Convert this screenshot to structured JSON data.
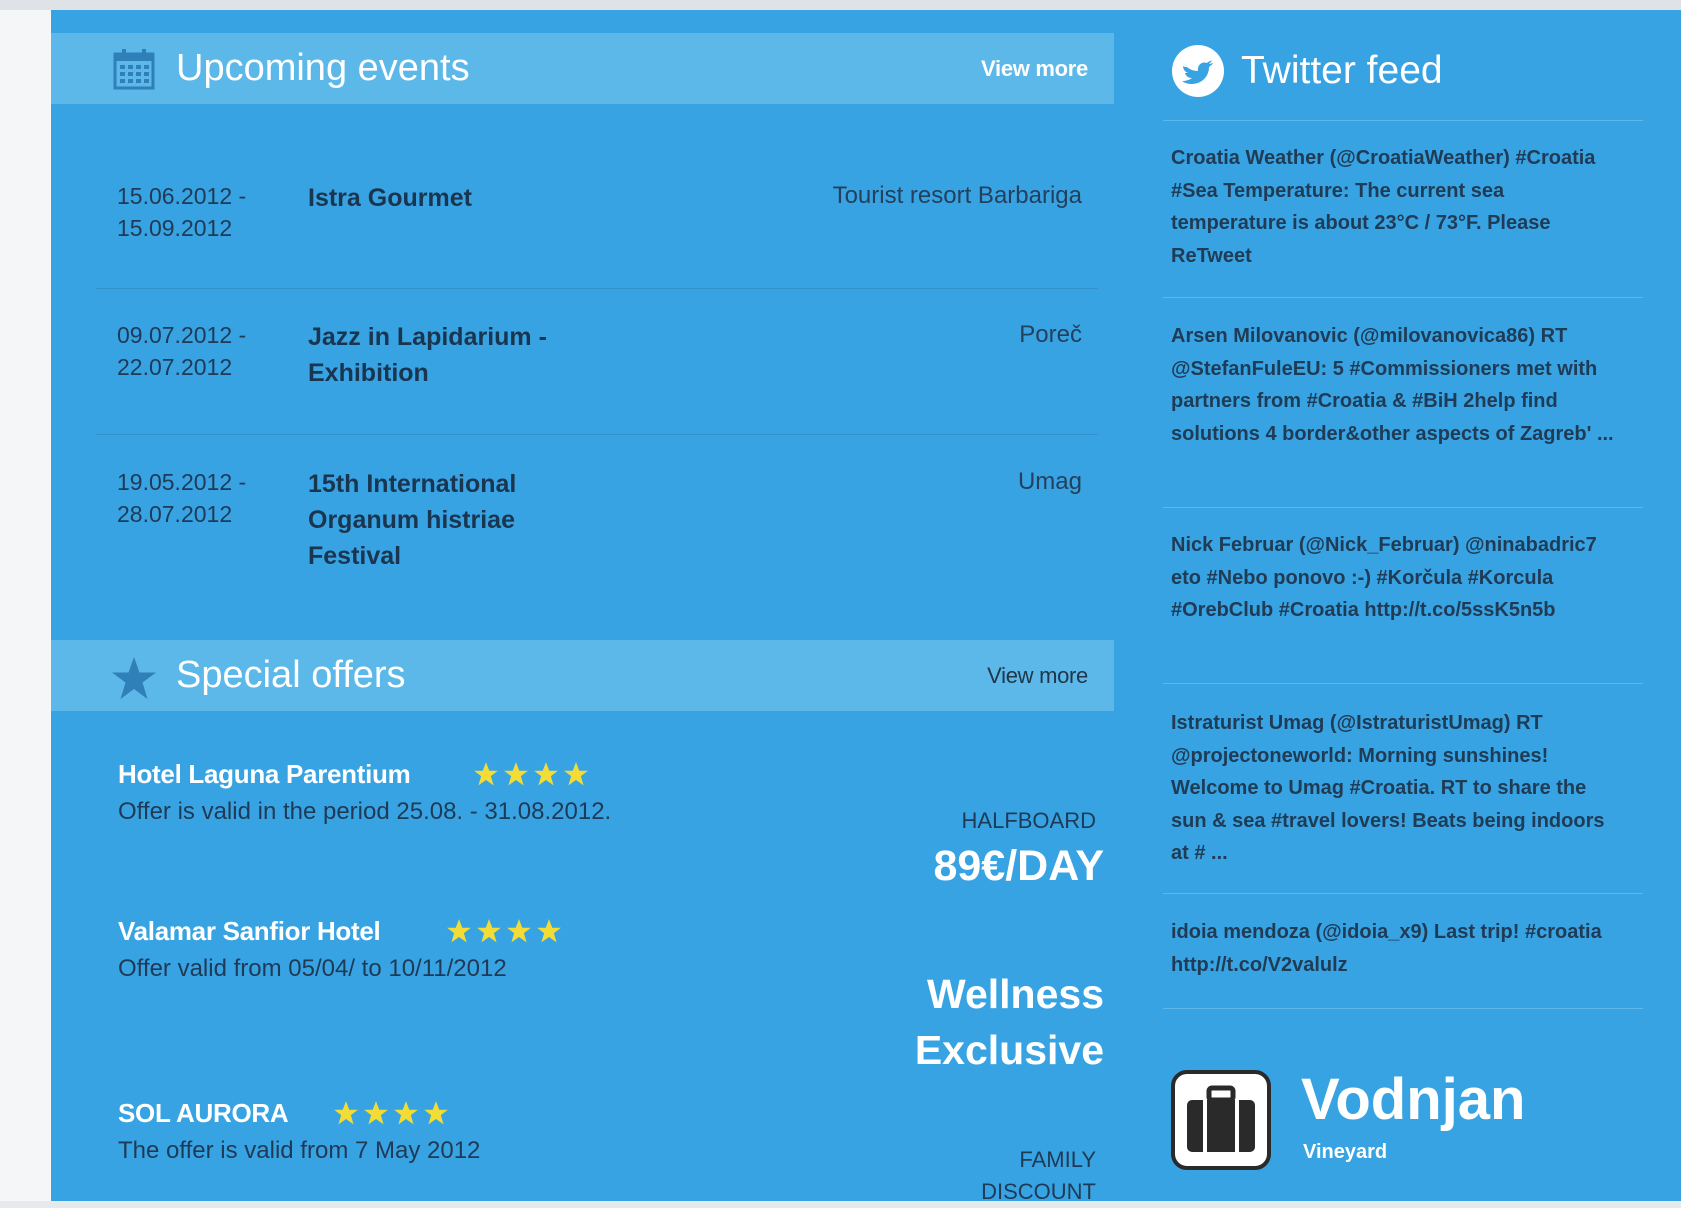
{
  "events": {
    "title": "Upcoming events",
    "view_more": "View more",
    "items": [
      {
        "date": "15.06.2012 -\n15.09.2012",
        "name": "Istra Gourmet",
        "location": "Tourist resort Barbariga"
      },
      {
        "date": "09.07.2012 -\n22.07.2012",
        "name": "Jazz in Lapidarium -\nExhibition",
        "location": "Poreč"
      },
      {
        "date": "19.05.2012 -\n28.07.2012",
        "name": "15th International\nOrganum histriae\nFestival",
        "location": "Umag"
      }
    ]
  },
  "offers": {
    "title": "Special offers",
    "view_more": "View more",
    "items": [
      {
        "name": "Hotel Laguna Parentium",
        "stars": 4,
        "description": "Offer is valid in the period 25.08. - 31.08.2012.",
        "label": "HALFBOARD",
        "price": "89€/DAY"
      },
      {
        "name": "Valamar Sanfior Hotel",
        "stars": 4,
        "description": "Offer valid from 05/04/ to 10/11/2012",
        "price": "Wellness\nExclusive"
      },
      {
        "name": "SOL AURORA",
        "stars": 4,
        "description": "The offer is valid from 7 May 2012",
        "label": "FAMILY\nDISCOUNT"
      }
    ]
  },
  "twitter": {
    "title": "Twitter feed",
    "tweets": [
      "Croatia Weather (@CroatiaWeather) #Croatia #Sea Temperature: The current sea temperature is about 23°C / 73°F. Please ReTweet",
      "Arsen Milovanovic (@milovanovica86) RT @StefanFuleEU: 5 #Commissioners met with partners from #Croatia & #BiH 2help find solutions 4 border&other aspects of Zagreb' ...",
      "Nick Februar (@Nick_Februar) @ninabadric7 eto #Nebo ponovo :-) #Korčula #Korcula #OrebClub #Croatia http://t.co/5ssK5n5b",
      "Istraturist Umag (@IstraturistUmag) RT @projectoneworld: Morning sunshines! Welcome to Umag #Croatia. RT to share the sun & sea #travel lovers! Beats being indoors at # ...",
      "idoia mendoza (@idoia_x9) Last trip! #croatia http://t.co/V2valulz"
    ]
  },
  "brand": {
    "name": "Vodnjan",
    "subtitle": "Vineyard"
  },
  "colors": {
    "background": "#38a3e2",
    "header_band": "#5cb8e8",
    "star": "#f2dc35",
    "dark_text": "#1f3a56"
  }
}
